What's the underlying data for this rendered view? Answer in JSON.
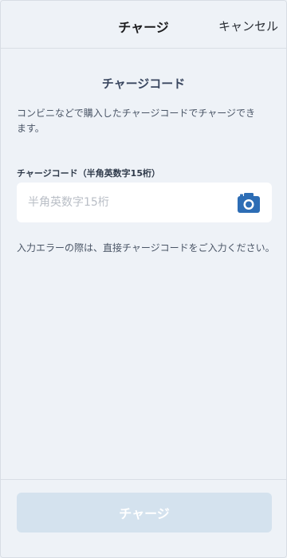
{
  "header": {
    "title": "チャージ",
    "cancel_label": "キャンセル"
  },
  "main": {
    "section_title": "チャージコード",
    "description": "コンビニなどで購入したチャージコードでチャージできます。",
    "field_label": "チャージコード（半角英数字15桁）",
    "field_placeholder": "半角英数字15桁",
    "field_value": "",
    "camera_icon": "camera-icon",
    "note": "入力エラーの際は、直接チャージコードをご入力ください。"
  },
  "footer": {
    "charge_button_label": "チャージ",
    "charge_button_state": "disabled"
  },
  "colors": {
    "background": "#eef2f7",
    "accent": "#2d6db5",
    "button_disabled": "#d4e2ee"
  }
}
